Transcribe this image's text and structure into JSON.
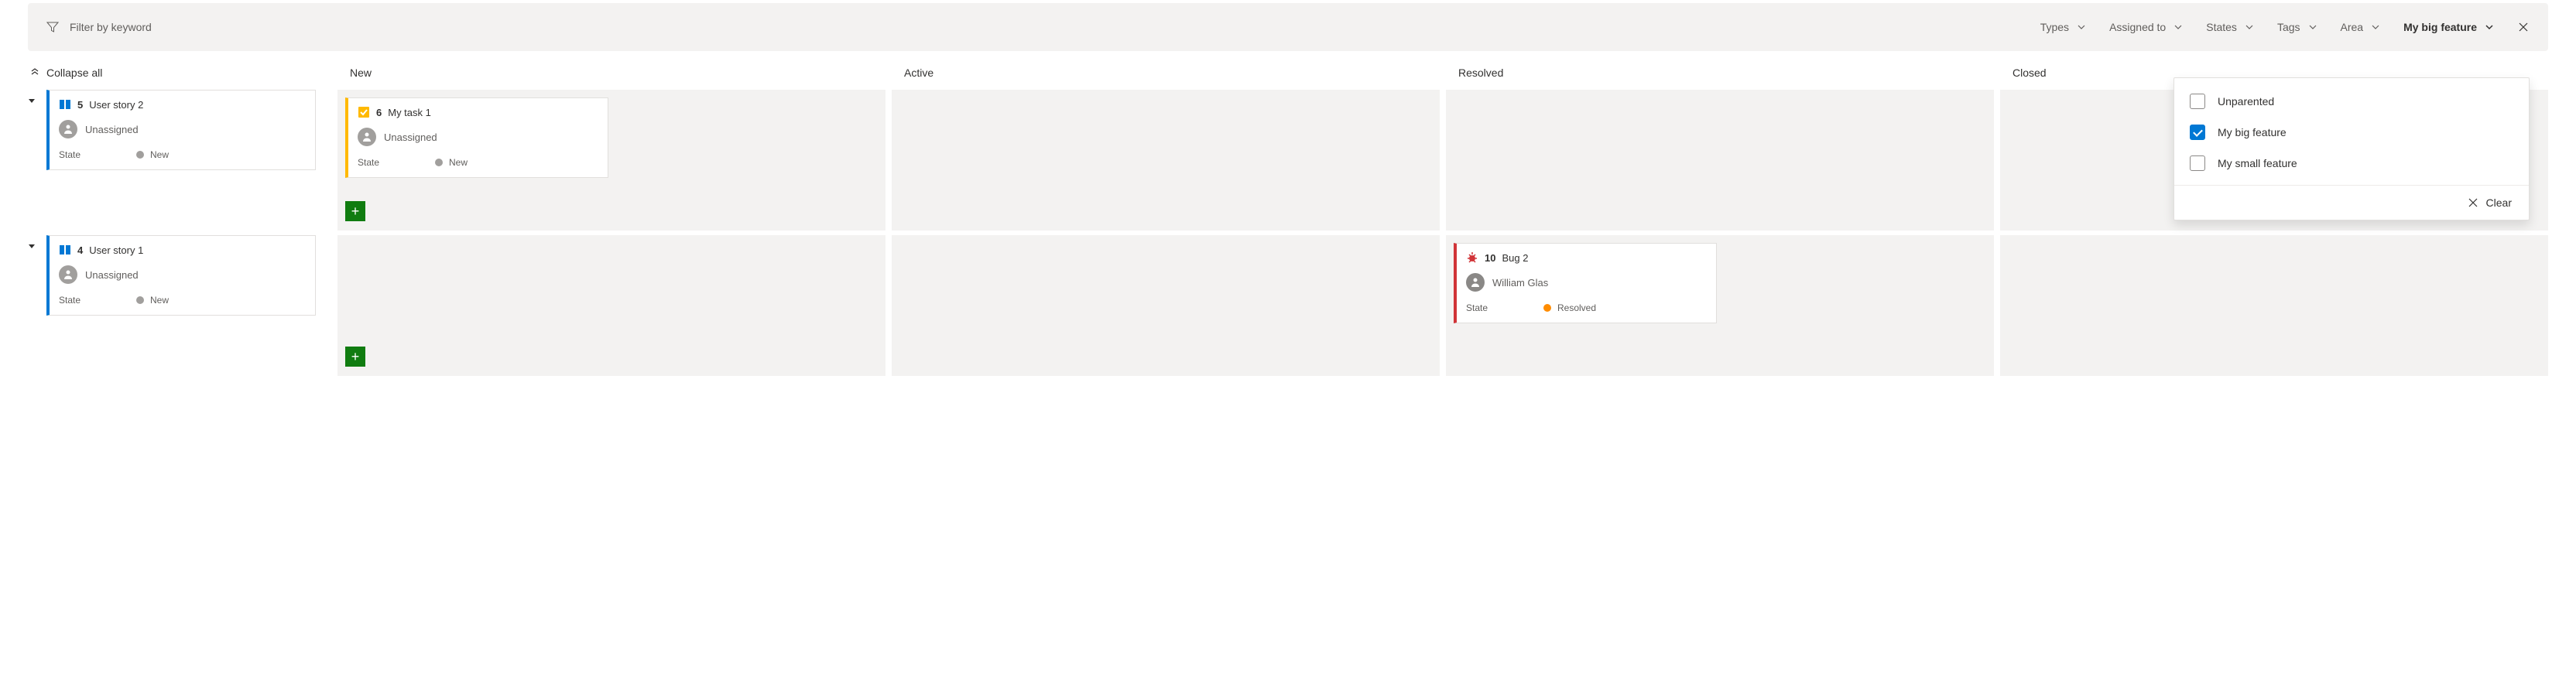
{
  "filter": {
    "placeholder": "Filter by keyword",
    "pills": {
      "types": "Types",
      "assigned": "Assigned to",
      "states": "States",
      "tags": "Tags",
      "area": "Area",
      "parent": "My big feature"
    }
  },
  "dropdown": {
    "options": [
      {
        "label": "Unparented",
        "checked": false
      },
      {
        "label": "My big feature",
        "checked": true
      },
      {
        "label": "My small feature",
        "checked": false
      }
    ],
    "clear": "Clear"
  },
  "collapseAll": "Collapse all",
  "columns": [
    "New",
    "Active",
    "Resolved",
    "Closed"
  ],
  "swimlanes": [
    {
      "parent": {
        "id": "5",
        "title": "User story 2",
        "assignee": "Unassigned",
        "stateLabel": "State",
        "state": "New",
        "color": "blue"
      },
      "cells": {
        "New": [
          {
            "id": "6",
            "title": "My task 1",
            "assignee": "Unassigned",
            "stateLabel": "State",
            "state": "New",
            "type": "task",
            "color": "yellow"
          }
        ],
        "Active": [],
        "Resolved": [],
        "Closed": []
      }
    },
    {
      "parent": {
        "id": "4",
        "title": "User story 1",
        "assignee": "Unassigned",
        "stateLabel": "State",
        "state": "New",
        "color": "blue"
      },
      "cells": {
        "New": [],
        "Active": [],
        "Resolved": [
          {
            "id": "10",
            "title": "Bug 2",
            "assignee": "William Glas",
            "stateLabel": "State",
            "state": "Resolved",
            "type": "bug",
            "color": "red"
          }
        ],
        "Closed": []
      }
    }
  ]
}
